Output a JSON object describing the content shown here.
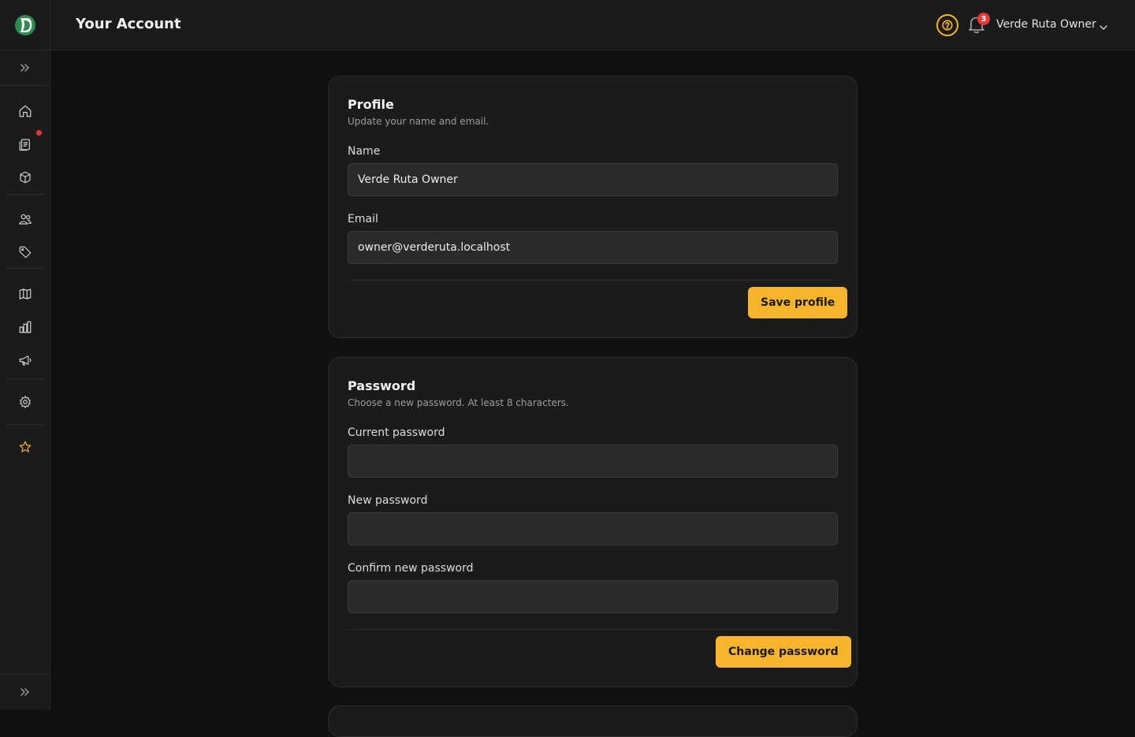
{
  "header": {
    "title": "Your Account",
    "notifications_count": "3",
    "user_name": "Verde Ruta Owner"
  },
  "sidebar": {
    "items": [
      {
        "icon": "home-icon",
        "label": "Home"
      },
      {
        "icon": "clipboard-icon",
        "label": "Orders"
      },
      {
        "icon": "box-icon",
        "label": "Products"
      },
      {
        "icon": "users-icon",
        "label": "Customers"
      },
      {
        "icon": "tag-icon",
        "label": "Discounts"
      },
      {
        "icon": "map-icon",
        "label": "Routes"
      },
      {
        "icon": "chart-icon",
        "label": "Analytics"
      },
      {
        "icon": "megaphone-icon",
        "label": "Marketing"
      },
      {
        "icon": "gear-icon",
        "label": "Settings"
      },
      {
        "icon": "star-icon",
        "label": "Favorites"
      }
    ]
  },
  "profile": {
    "title": "Profile",
    "subtitle": "Update your name and email.",
    "name_label": "Name",
    "name_value": "Verde Ruta Owner",
    "email_label": "Email",
    "email_value": "owner@verderuta.localhost",
    "save_label": "Save profile"
  },
  "password": {
    "title": "Password",
    "subtitle": "Choose a new password. At least 8 characters.",
    "current_label": "Current password",
    "current_value": "",
    "new_label": "New password",
    "new_value": "",
    "confirm_label": "Confirm new password",
    "confirm_value": "",
    "change_label": "Change password"
  },
  "colors": {
    "accent": "#f6b52d",
    "background": "#111111",
    "surface": "#1b1b1b",
    "input": "#2a2a2a",
    "alert": "#e5383b"
  }
}
